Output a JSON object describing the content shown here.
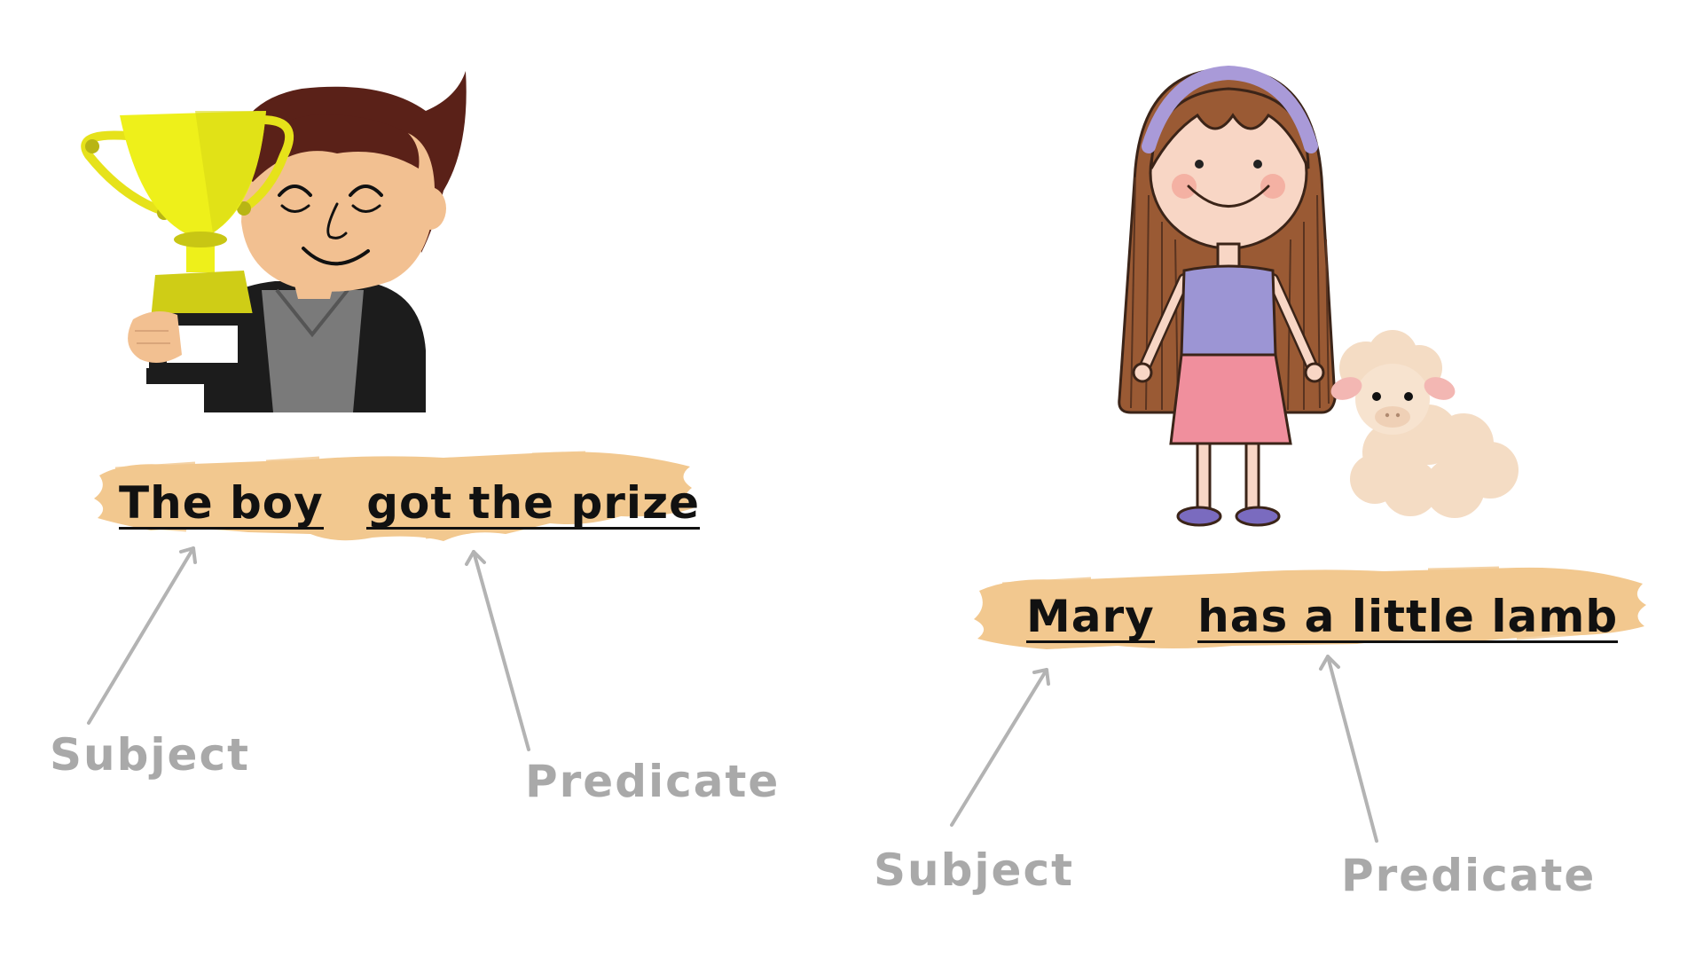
{
  "examples": [
    {
      "subject": "The boy",
      "predicate": "got the prize",
      "subject_label": "Subject",
      "predicate_label": "Predicate",
      "illustration": "boy-with-trophy"
    },
    {
      "subject": "Mary",
      "predicate": "has a little lamb",
      "subject_label": "Subject",
      "predicate_label": "Predicate",
      "illustration": "girl-with-lamb"
    }
  ],
  "colors": {
    "brush": "#f2c88f",
    "text": "#111111",
    "label": "#a9a9a9",
    "arrow": "#b3b3b3"
  }
}
